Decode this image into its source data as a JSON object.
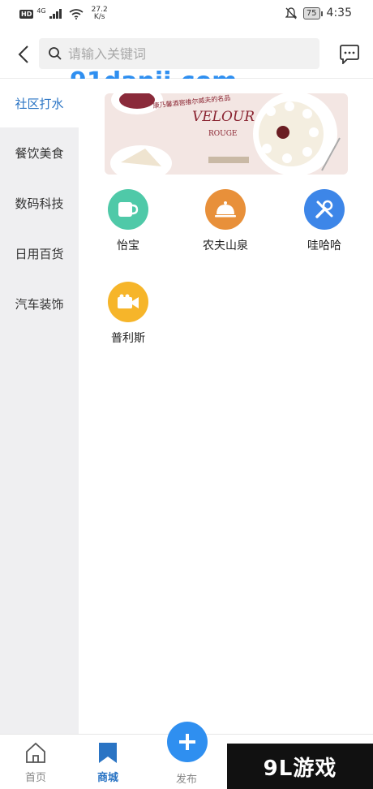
{
  "status_bar": {
    "hd": "HD",
    "network": "4G",
    "speed_value": "27.2",
    "speed_unit": "K/s",
    "battery": "75",
    "time": "4:35"
  },
  "header": {
    "search_placeholder": "请输入关键词"
  },
  "watermark": {
    "top_text": "91danji.com",
    "bottom_text": "9L游戏"
  },
  "sidebar": {
    "items": [
      {
        "label": "社区打水",
        "active": true
      },
      {
        "label": "餐饮美食",
        "active": false
      },
      {
        "label": "数码科技",
        "active": false
      },
      {
        "label": "日用百货",
        "active": false
      },
      {
        "label": "汽车装饰",
        "active": false
      }
    ]
  },
  "banner": {
    "brand": "VELOUR",
    "sub": "ROUGE",
    "tagline": "康乃馨酒窖维尔威夫的名品"
  },
  "shops": [
    {
      "name": "怡宝",
      "icon": "cup-icon",
      "color": "#4fc9a8"
    },
    {
      "name": "农夫山泉",
      "icon": "cloche-icon",
      "color": "#e8903a"
    },
    {
      "name": "哇哈哈",
      "icon": "tools-icon",
      "color": "#3d86e8"
    },
    {
      "name": "普利斯",
      "icon": "video-camera-icon",
      "color": "#f6b52a"
    }
  ],
  "bottom_nav": {
    "home": "首页",
    "mall": "商城",
    "publish": "发布"
  },
  "colors": {
    "accent": "#2a74c4",
    "publish_button": "#2f8ff0"
  }
}
